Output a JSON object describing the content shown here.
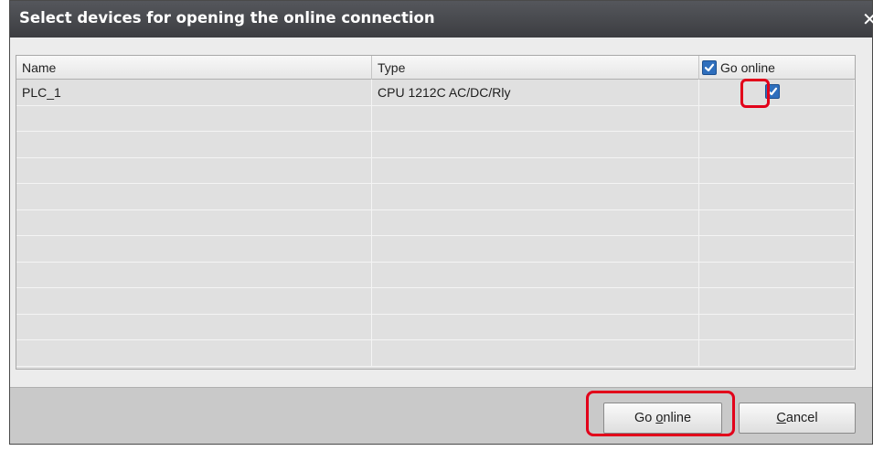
{
  "dialog": {
    "title": "Select devices for opening the online connection",
    "close_icon": "close-icon"
  },
  "table": {
    "columns": {
      "name": "Name",
      "type": "Type",
      "go_online": "Go online"
    },
    "header_checkbox_checked": true,
    "rows": [
      {
        "name": "PLC_1",
        "type": "CPU 1212C AC/DC/Rly",
        "go_online": true
      }
    ]
  },
  "buttons": {
    "go_online": {
      "pre": "Go ",
      "mnemonic": "o",
      "post": "nline"
    },
    "cancel": {
      "pre": "",
      "mnemonic": "C",
      "post": "ancel"
    }
  },
  "colors": {
    "titlebar": "#46474b",
    "checkbox": "#2f6fbd",
    "highlight": "#e2001a"
  }
}
